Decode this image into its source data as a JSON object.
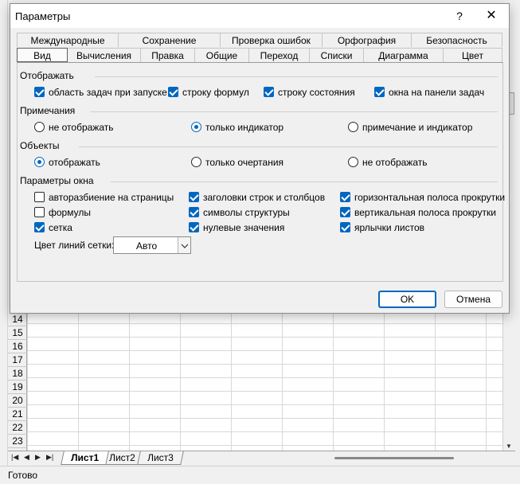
{
  "spreadsheet": {
    "row_numbers": [
      "14",
      "15",
      "16",
      "17",
      "18",
      "19",
      "20",
      "21",
      "22",
      "23"
    ],
    "sheet_tabs": [
      {
        "label": "Лист1",
        "active": true
      },
      {
        "label": "Лист2",
        "active": false
      },
      {
        "label": "Лист3",
        "active": false
      }
    ],
    "status_text": "Готово"
  },
  "dialog": {
    "title": "Параметры",
    "help_label": "?",
    "close_label": "✕",
    "tabs_back": [
      "Международные",
      "Сохранение",
      "Проверка ошибок",
      "Орфография",
      "Безопасность"
    ],
    "tabs_front": [
      "Вид",
      "Вычисления",
      "Правка",
      "Общие",
      "Переход",
      "Списки",
      "Диаграмма",
      "Цвет"
    ],
    "active_tab": "Вид",
    "display": {
      "title": "Отображать",
      "options": [
        {
          "label": "область задач при запуске",
          "checked": true
        },
        {
          "label": "строку формул",
          "checked": true
        },
        {
          "label": "строку состояния",
          "checked": true
        },
        {
          "label": "окна на панели задач",
          "checked": true
        }
      ]
    },
    "comments": {
      "title": "Примечания",
      "options": [
        {
          "label": "не отображать",
          "selected": false
        },
        {
          "label": "только индикатор",
          "selected": true
        },
        {
          "label": "примечание и индикатор",
          "selected": false
        }
      ]
    },
    "objects": {
      "title": "Объекты",
      "options": [
        {
          "label": "отображать",
          "selected": true
        },
        {
          "label": "только очертания",
          "selected": false
        },
        {
          "label": "не отображать",
          "selected": false
        }
      ]
    },
    "window_options": {
      "title": "Параметры окна",
      "options": [
        {
          "label": "авторазбиение на страницы",
          "checked": false
        },
        {
          "label": "формулы",
          "checked": false
        },
        {
          "label": "сетка",
          "checked": true
        },
        {
          "label": "заголовки строк и столбцов",
          "checked": true
        },
        {
          "label": "символы структуры",
          "checked": true
        },
        {
          "label": "нулевые значения",
          "checked": true
        },
        {
          "label": "горизонтальная полоса прокрутки",
          "checked": true
        },
        {
          "label": "вертикальная полоса прокрутки",
          "checked": true
        },
        {
          "label": "ярлычки листов",
          "checked": true
        }
      ],
      "grid_color_label": "Цвет линий сетки:",
      "grid_color_value": "Авто"
    },
    "ok_label": "OK",
    "cancel_label": "Отмена"
  },
  "colors": {
    "accent": "#0067c0",
    "dialog_bg": "#f0f0f0"
  }
}
